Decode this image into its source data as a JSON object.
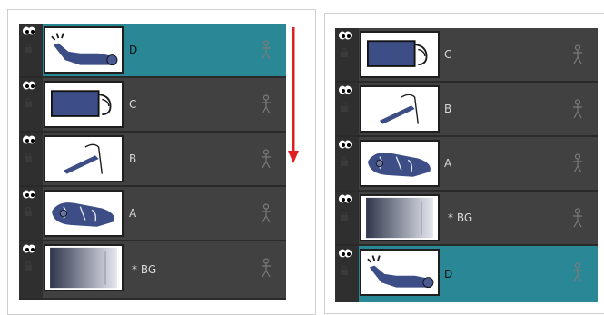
{
  "left_panel": {
    "layers": [
      {
        "label": "D",
        "selected": true,
        "thumbnail": "arm-drawing"
      },
      {
        "label": "C",
        "selected": false,
        "thumbnail": "box-drawing"
      },
      {
        "label": "B",
        "selected": false,
        "thumbnail": "stroke-drawing"
      },
      {
        "label": "A",
        "selected": false,
        "thumbnail": "body-drawing"
      },
      {
        "label": "* BG",
        "selected": false,
        "thumbnail": "gradient-background"
      }
    ],
    "arrow": {
      "direction": "down",
      "color": "#e02020"
    }
  },
  "right_panel": {
    "layers": [
      {
        "label": "C",
        "selected": false,
        "thumbnail": "box-drawing"
      },
      {
        "label": "B",
        "selected": false,
        "thumbnail": "stroke-drawing"
      },
      {
        "label": "A",
        "selected": false,
        "thumbnail": "body-drawing"
      },
      {
        "label": "* BG",
        "selected": false,
        "thumbnail": "gradient-background"
      },
      {
        "label": "D",
        "selected": true,
        "thumbnail": "arm-drawing"
      }
    ]
  },
  "colors": {
    "selected_row": "#2a8796",
    "row": "#414141",
    "sketch": "#3d4e86"
  }
}
